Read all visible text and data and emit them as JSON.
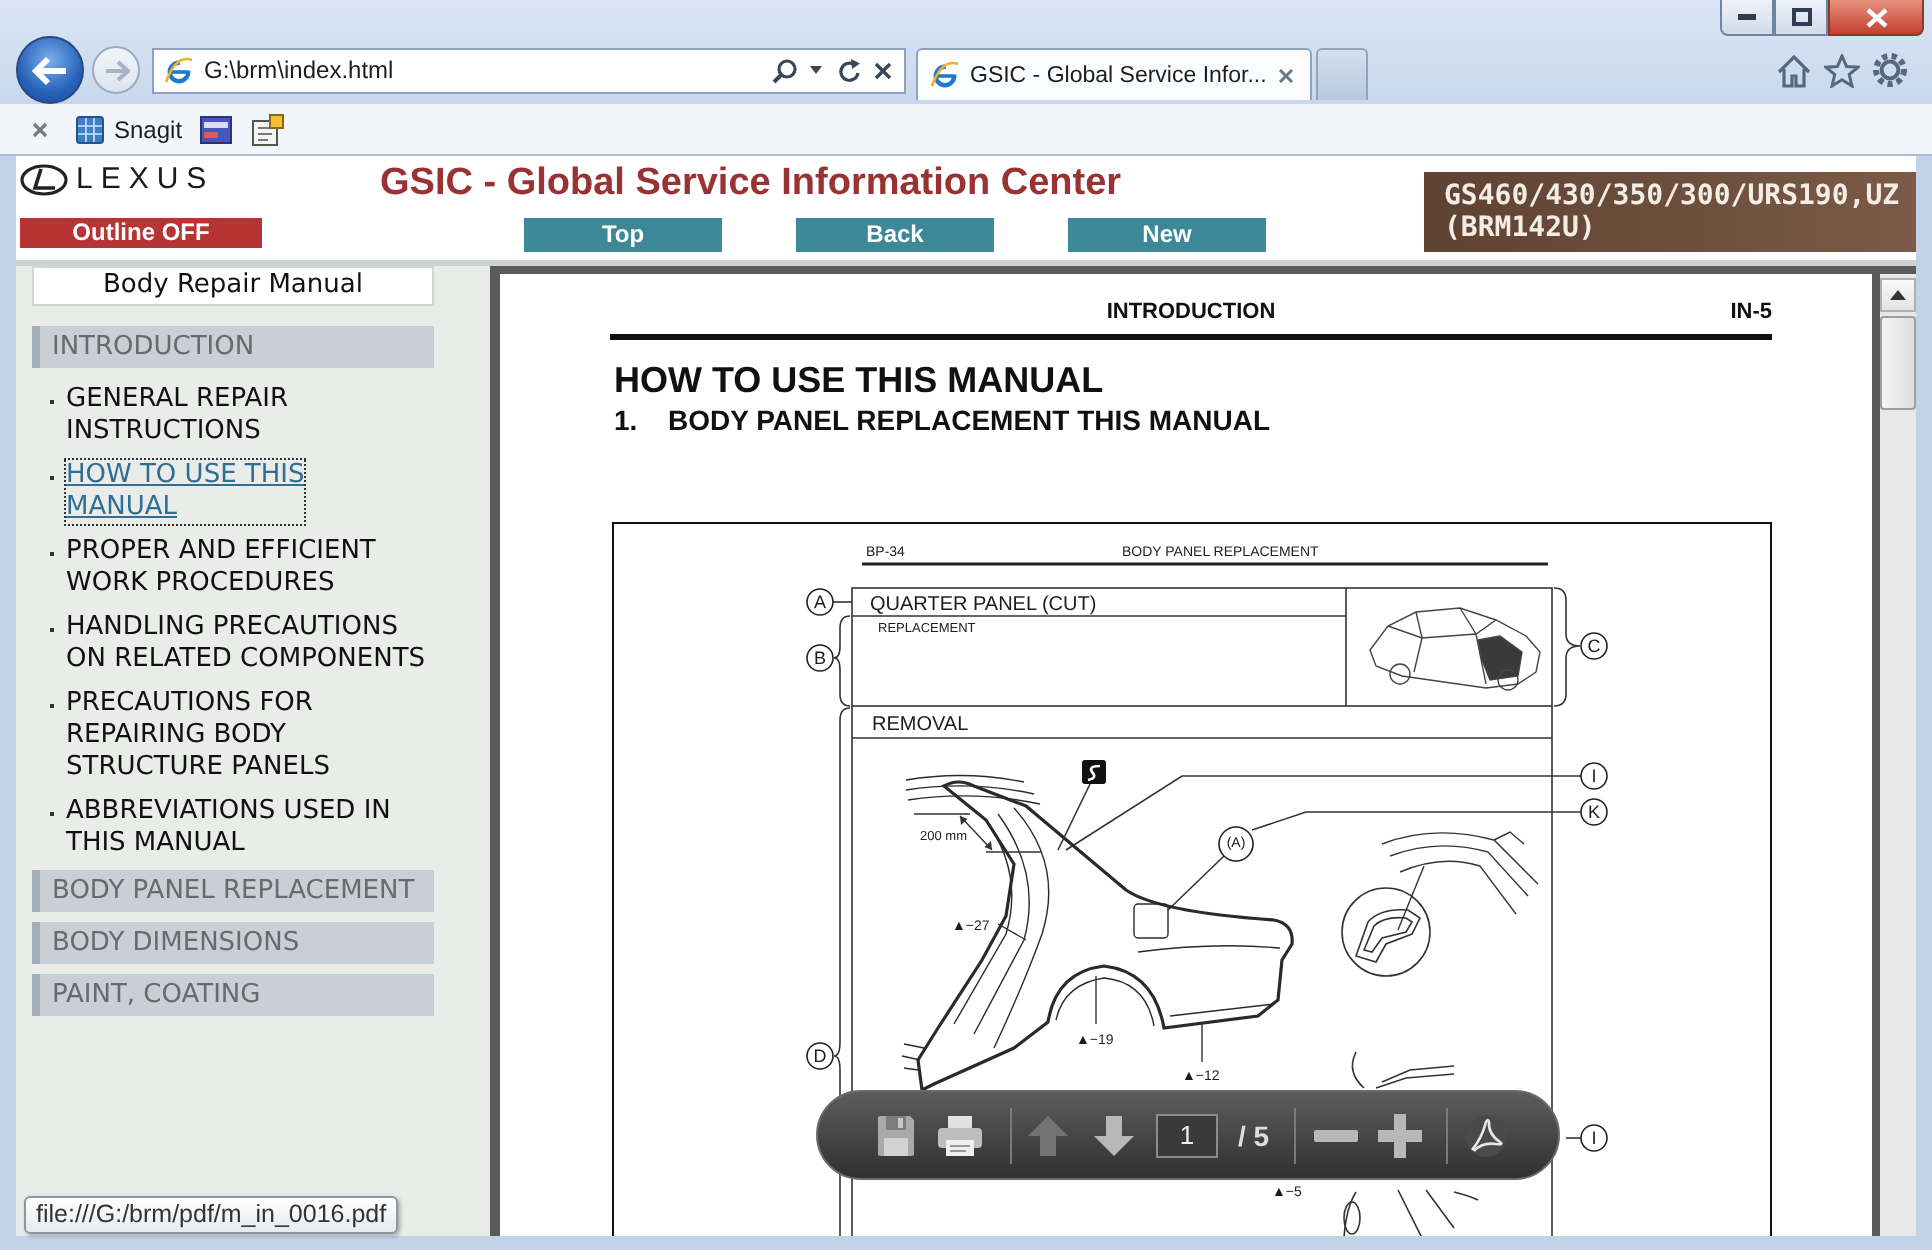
{
  "browser": {
    "forward_disabled": true,
    "address": "G:\\brm\\index.html",
    "tabs": [
      {
        "label": "GSIC - Global Service Infor...",
        "selected": true
      }
    ],
    "favorites": [
      {
        "label": "Snagit"
      }
    ]
  },
  "header": {
    "logo": "LEXUS",
    "title": "GSIC - Global Service Information Center",
    "outline_button": "Outline OFF",
    "nav_buttons": [
      "Top",
      "Back",
      "New"
    ],
    "model": [
      "GS460/430/350/300/URS190,UZ",
      "(BRM142U)"
    ]
  },
  "sidebar": {
    "title": "Body Repair Manual",
    "sections": [
      {
        "label": "INTRODUCTION",
        "children": [
          {
            "label": "GENERAL REPAIR\nINSTRUCTIONS",
            "selected": false
          },
          {
            "label": "HOW TO USE THIS\nMANUAL",
            "selected": true
          },
          {
            "label": "PROPER AND EFFICIENT\nWORK PROCEDURES",
            "selected": false
          },
          {
            "label": "HANDLING PRECAUTIONS\nON RELATED COMPONENTS",
            "selected": false
          },
          {
            "label": "PRECAUTIONS FOR\nREPAIRING BODY\nSTRUCTURE PANELS",
            "selected": false
          },
          {
            "label": "ABBREVIATIONS USED IN\nTHIS MANUAL",
            "selected": false
          }
        ]
      },
      {
        "label": "BODY PANEL REPLACEMENT"
      },
      {
        "label": "BODY DIMENSIONS"
      },
      {
        "label": "PAINT, COATING"
      }
    ]
  },
  "document": {
    "running_header": "INTRODUCTION",
    "page_number": "IN-5",
    "title": "HOW TO USE THIS MANUAL",
    "section_number": "1.",
    "section_title": "BODY PANEL REPLACEMENT THIS MANUAL",
    "figure": {
      "page_code": "BP-34",
      "page_title": "BODY PANEL REPLACEMENT",
      "part_name": "QUARTER PANEL (CUT)",
      "operation": "REPLACEMENT",
      "step": "REMOVAL",
      "dimension": "200 mm",
      "callouts": [
        "A",
        "B",
        "C",
        "D",
        "I",
        "K",
        "(A)",
        "I"
      ],
      "weld_labels": [
        "▲−27",
        "▲−19",
        "▲−12",
        "▲−5"
      ]
    }
  },
  "pdf_toolbar": {
    "page": "1",
    "page_count": "/ 5",
    "previous_disabled": true,
    "next_disabled": false
  },
  "status_tooltip": "file:///G:/brm/pdf/m_in_0016.pdf"
}
